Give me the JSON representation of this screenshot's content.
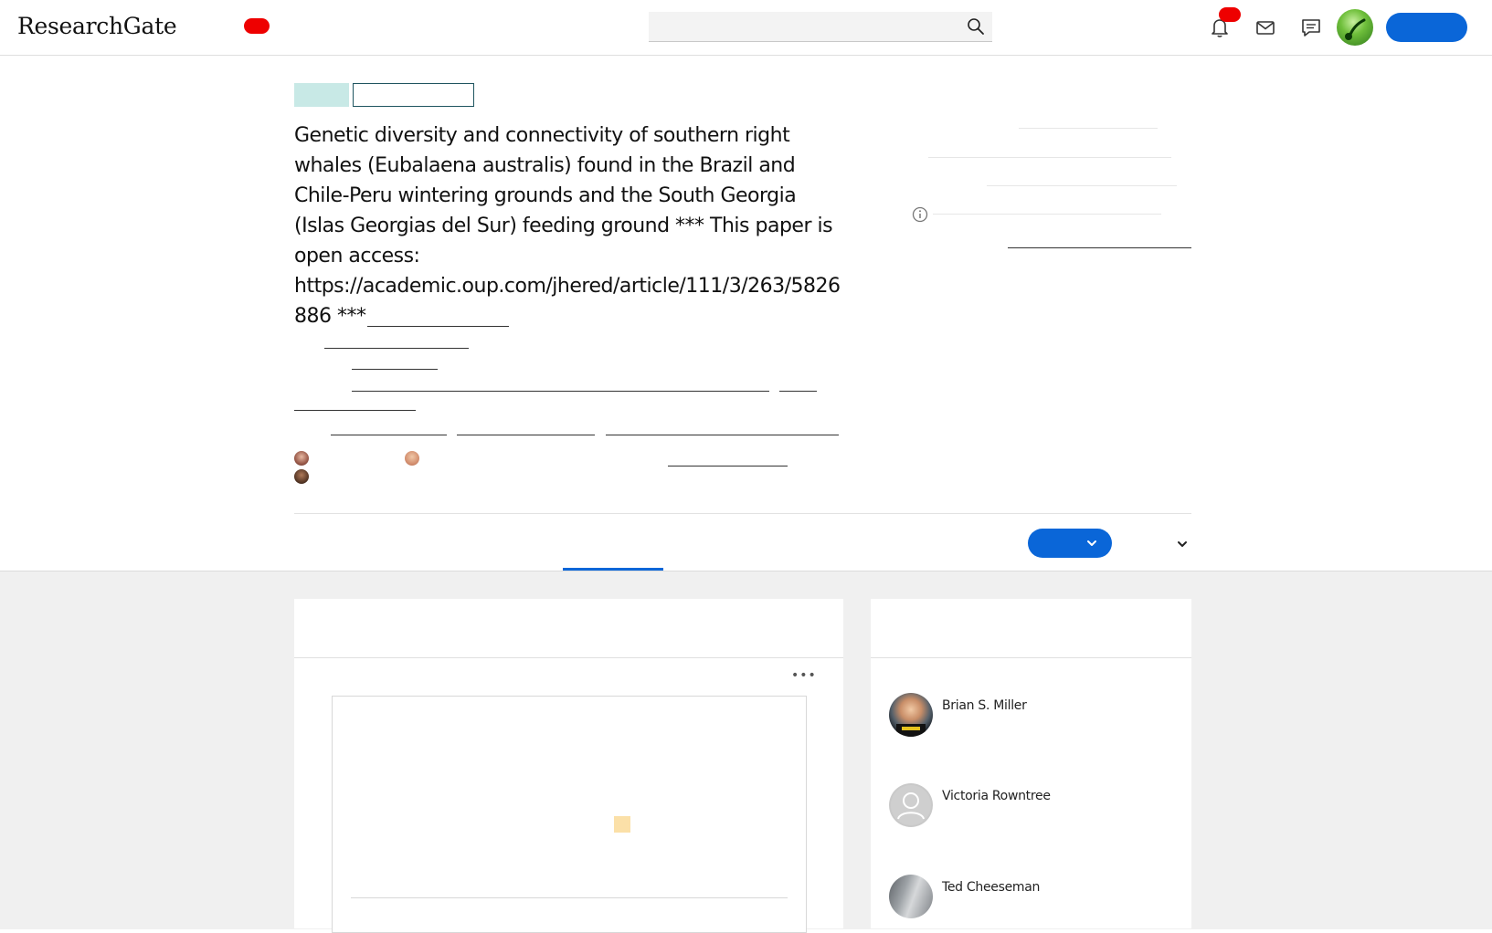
{
  "header": {
    "logo": "ResearchGate",
    "search": {
      "placeholder": ""
    },
    "colors": {
      "accent": "#0a66d8",
      "badge": "#ee0000"
    },
    "icons": [
      "search-icon",
      "bell-icon",
      "mail-icon",
      "chat-icon"
    ]
  },
  "publication": {
    "title": "Genetic diversity and connectivity of southern right whales (Eubalaena australis) found in the Brazil and Chile-Peru wintering grounds and the South Georgia (Islas Georgias del Sur) feeding ground *** This paper is open access: https://academic.oup.com/jhered/article/111/3/263/5826886 ***"
  },
  "people": [
    {
      "name": "Brian S. Miller",
      "avatar": "brian-photo"
    },
    {
      "name": "Victoria Rowntree",
      "avatar": "default-user"
    },
    {
      "name": "Ted Cheeseman",
      "avatar": "ted-photo"
    }
  ],
  "preview": {
    "menu_label": "•••"
  }
}
